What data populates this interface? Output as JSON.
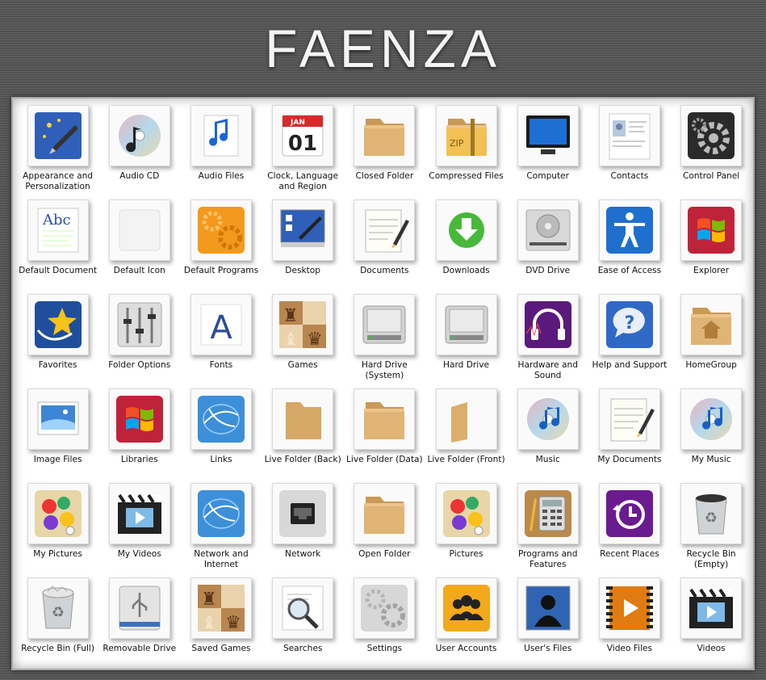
{
  "title": "FAENZA",
  "icons": [
    {
      "label": "Appearance and Personalization",
      "icon": "appearance-icon"
    },
    {
      "label": "Audio CD",
      "icon": "audio-cd-icon"
    },
    {
      "label": "Audio Files",
      "icon": "audio-files-icon"
    },
    {
      "label": "Clock, Language and Region",
      "icon": "calendar-icon",
      "month": "JAN",
      "day": "01"
    },
    {
      "label": "Closed Folder",
      "icon": "closed-folder-icon"
    },
    {
      "label": "Compressed Files",
      "icon": "zip-folder-icon",
      "badge": "ZIP"
    },
    {
      "label": "Computer",
      "icon": "monitor-icon"
    },
    {
      "label": "Contacts",
      "icon": "contact-card-icon"
    },
    {
      "label": "Control Panel",
      "icon": "gear-icon"
    },
    {
      "label": "Default Document",
      "icon": "document-abc-icon",
      "text": "Abc"
    },
    {
      "label": "Default Icon",
      "icon": "blank-icon"
    },
    {
      "label": "Default Programs",
      "icon": "orange-gears-icon"
    },
    {
      "label": "Desktop",
      "icon": "desktop-icon"
    },
    {
      "label": "Documents",
      "icon": "notepad-pencil-icon"
    },
    {
      "label": "Downloads",
      "icon": "download-arrow-icon"
    },
    {
      "label": "DVD Drive",
      "icon": "dvd-drive-icon"
    },
    {
      "label": "Ease of Access",
      "icon": "accessibility-icon"
    },
    {
      "label": "Explorer",
      "icon": "windows-logo-icon"
    },
    {
      "label": "Favorites",
      "icon": "star-icon"
    },
    {
      "label": "Folder Options",
      "icon": "sliders-icon"
    },
    {
      "label": "Fonts",
      "icon": "font-icon",
      "text": "A"
    },
    {
      "label": "Games",
      "icon": "chess-icon"
    },
    {
      "label": "Hard Drive (System)",
      "icon": "hard-drive-icon"
    },
    {
      "label": "Hard Drive",
      "icon": "hard-drive-icon"
    },
    {
      "label": "Hardware and Sound",
      "icon": "headphones-icon"
    },
    {
      "label": "Help and Support",
      "icon": "help-bubble-icon",
      "text": "?"
    },
    {
      "label": "HomeGroup",
      "icon": "home-folder-icon"
    },
    {
      "label": "Image Files",
      "icon": "image-icon"
    },
    {
      "label": "Libraries",
      "icon": "windows-logo-icon"
    },
    {
      "label": "Links",
      "icon": "globe-links-icon"
    },
    {
      "label": "Live Folder (Back)",
      "icon": "folder-back-icon"
    },
    {
      "label": "Live Folder (Data)",
      "icon": "closed-folder-icon"
    },
    {
      "label": "Live Folder (Front)",
      "icon": "folder-front-icon"
    },
    {
      "label": "Music",
      "icon": "music-cd-icon"
    },
    {
      "label": "My Documents",
      "icon": "notepad-pencil-icon"
    },
    {
      "label": "My Music",
      "icon": "music-cd-icon"
    },
    {
      "label": "My Pictures",
      "icon": "paint-palette-icon"
    },
    {
      "label": "My Videos",
      "icon": "clapper-icon"
    },
    {
      "label": "Network and Internet",
      "icon": "globe-links-icon"
    },
    {
      "label": "Network",
      "icon": "ethernet-icon"
    },
    {
      "label": "Open Folder",
      "icon": "closed-folder-icon"
    },
    {
      "label": "Pictures",
      "icon": "paint-palette-icon"
    },
    {
      "label": "Programs and Features",
      "icon": "calculator-icon"
    },
    {
      "label": "Recent Places",
      "icon": "history-clock-icon"
    },
    {
      "label": "Recycle Bin (Empty)",
      "icon": "recycle-bin-icon"
    },
    {
      "label": "Recycle Bin (Full)",
      "icon": "recycle-bin-full-icon"
    },
    {
      "label": "Removable Drive",
      "icon": "usb-icon"
    },
    {
      "label": "Saved Games",
      "icon": "chess-icon"
    },
    {
      "label": "Searches",
      "icon": "magnifier-icon"
    },
    {
      "label": "Settings",
      "icon": "gray-gears-icon"
    },
    {
      "label": "User Accounts",
      "icon": "users-icon"
    },
    {
      "label": "User's Files",
      "icon": "user-silhouette-icon"
    },
    {
      "label": "Video Files",
      "icon": "film-play-icon"
    },
    {
      "label": "Videos",
      "icon": "clapper-icon"
    }
  ]
}
